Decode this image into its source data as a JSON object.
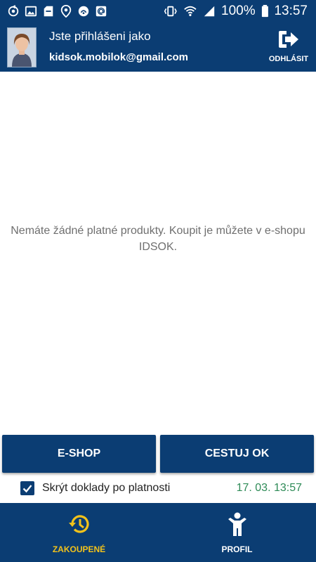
{
  "status_bar": {
    "battery": "100%",
    "time": "13:57",
    "notification_icons": [
      "sync-icon",
      "image-icon",
      "sd-card-icon",
      "location-icon",
      "wifi-calling-icon",
      "at-sign-icon"
    ]
  },
  "header": {
    "logged_in_label": "Jste přihlášeni jako",
    "email": "kidsok.mobilok@gmail.com",
    "logout_label": "ODHLÁSIT"
  },
  "main": {
    "empty_message": "Nemáte žádné platné produkty. Koupit je můžete v e-shopu IDSOK."
  },
  "actions": {
    "eshop_label": "E-SHOP",
    "cestuj_label": "CESTUJ OK"
  },
  "filter": {
    "label": "Skrýt doklady po platnosti",
    "checked": true,
    "timestamp": "17. 03. 13:57"
  },
  "bottom_nav": {
    "items": [
      {
        "label": "ZAKOUPENÉ",
        "icon": "history-icon",
        "active": true
      },
      {
        "label": "PROFIL",
        "icon": "person-icon",
        "active": false
      }
    ]
  },
  "colors": {
    "primary": "#0b3d73",
    "accent": "#f2c21b",
    "timestamp": "#2e8b57"
  }
}
